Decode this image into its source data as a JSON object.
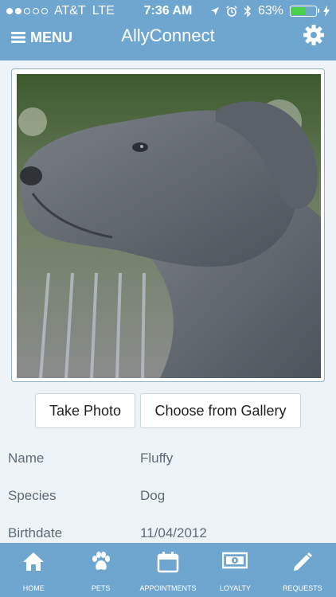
{
  "status_bar": {
    "carrier": "AT&T",
    "network": "LTE",
    "time": "7:36 AM",
    "battery_percent": "63%",
    "battery_level": 0.63,
    "signal_bars": 2
  },
  "header": {
    "menu_label": "MENU",
    "app_title": "AllyConnect"
  },
  "photo": {
    "buttons": {
      "take_photo": "Take Photo",
      "gallery": "Choose from Gallery"
    }
  },
  "pet": {
    "fields": [
      {
        "label": "Name",
        "value": "Fluffy"
      },
      {
        "label": "Species",
        "value": "Dog"
      },
      {
        "label": "Birthdate",
        "value": "11/04/2012"
      }
    ]
  },
  "tabs": [
    {
      "label": "HOME",
      "icon": "home-icon"
    },
    {
      "label": "PETS",
      "icon": "paw-icon"
    },
    {
      "label": "APPOINTMENTS",
      "icon": "calendar-icon"
    },
    {
      "label": "LOYALTY",
      "icon": "money-icon"
    },
    {
      "label": "REQUESTS",
      "icon": "pencil-icon"
    }
  ],
  "colors": {
    "brand": "#6fa6d0",
    "background": "#eef3f8",
    "battery": "#49d04b"
  }
}
